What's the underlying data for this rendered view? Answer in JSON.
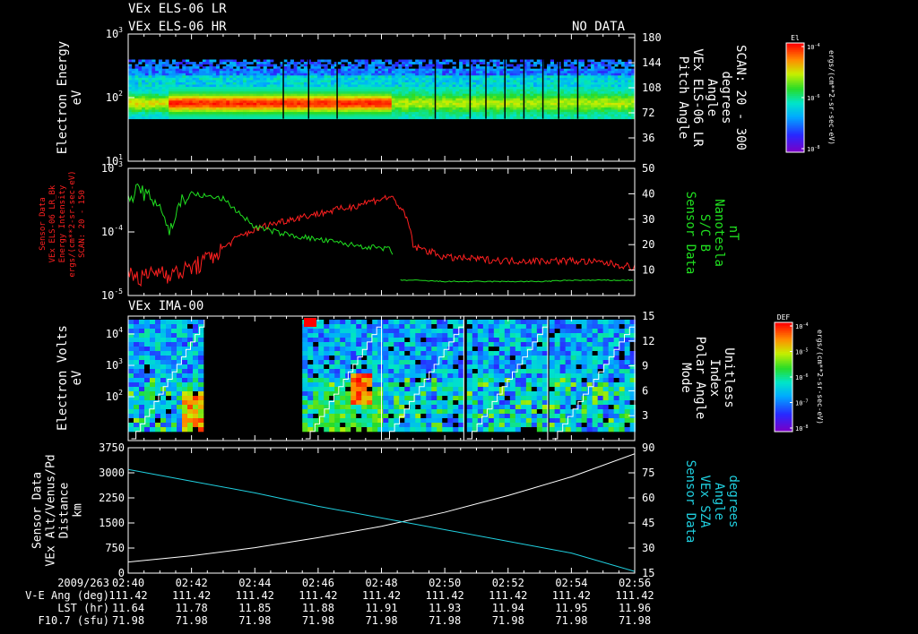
{
  "header": {
    "line1": "VEx ELS-06 LR",
    "line2": "VEx ELS-06 HR",
    "nodata": "NO DATA",
    "ima_title": "VEx IMA-00"
  },
  "panel1": {
    "ylabel": [
      "Electron Energy",
      "eV"
    ],
    "y_ticks": [
      {
        "exp": "3"
      },
      {
        "exp": "2"
      },
      {
        "exp": "1"
      }
    ],
    "y2_ticks": [
      "180",
      "144",
      "108",
      "72",
      "36"
    ],
    "y2label": [
      "Pitch Angle",
      "VEx ELS-06 LR",
      "Angle",
      "degrees",
      "SCAN: 20 - 300"
    ],
    "colorbar": {
      "title": "El",
      "tick_exps": [
        "-4",
        "-6",
        "-8"
      ],
      "label": "ergs/(cm**2-sr-sec-eV)"
    }
  },
  "panel2": {
    "ylabel": [
      "Sensor Data",
      "VEx ELS-06 LR_Bk",
      "Energy Intensity",
      "ergs/(cm**2-sr-sec-eV)",
      "SCAN: 20 - 150"
    ],
    "y_ticks": [
      {
        "exp": "-3"
      },
      {
        "exp": "-4"
      },
      {
        "exp": "-5"
      }
    ],
    "y2_ticks": [
      "50",
      "40",
      "30",
      "20",
      "10"
    ],
    "y2label": [
      "Sensor Data",
      "S/C B",
      "Nanotesla",
      "nT"
    ],
    "colors": {
      "red": "#ff2020",
      "green": "#20e020"
    }
  },
  "panel3": {
    "ylabel": [
      "Electron Volts",
      "eV"
    ],
    "y_ticks": [
      {
        "exp": "4"
      },
      {
        "exp": "3"
      },
      {
        "exp": "2"
      }
    ],
    "y2_ticks": [
      "15",
      "12",
      "9",
      "6",
      "3"
    ],
    "y2label": [
      "Mode",
      "Polar Angle",
      "Index",
      "Unitless"
    ],
    "colorbar": {
      "title": "DEF",
      "tick_exps": [
        "-4",
        "-5",
        "-6",
        "-7",
        "-8"
      ],
      "label": "ergs/(cm**2-sr-sec-eV)"
    }
  },
  "panel4": {
    "ylabel": [
      "Sensor Data",
      "VEx Alt/Venus/Pd",
      "Distance",
      "km"
    ],
    "y_ticks": [
      "3750",
      "3000",
      "2250",
      "1500",
      "750",
      "0"
    ],
    "y2_ticks": [
      "90",
      "75",
      "60",
      "45",
      "30",
      "15"
    ],
    "y2label": [
      "Sensor Data",
      "VEx SZA",
      "Angle",
      "degrees"
    ],
    "colors": {
      "alt": "#ffffff",
      "sza": "#20d0e0"
    }
  },
  "xaxis": {
    "ticks": [
      "02:40",
      "02:42",
      "02:44",
      "02:46",
      "02:48",
      "02:50",
      "02:52",
      "02:54",
      "02:56"
    ],
    "rows": [
      {
        "label": "2009/263",
        "values": [
          "02:40",
          "02:42",
          "02:44",
          "02:46",
          "02:48",
          "02:50",
          "02:52",
          "02:54",
          "02:56"
        ]
      },
      {
        "label": "V-E Ang (deg)",
        "values": [
          "111.42",
          "111.42",
          "111.42",
          "111.42",
          "111.42",
          "111.42",
          "111.42",
          "111.42",
          "111.42"
        ]
      },
      {
        "label": "LST (hr)",
        "values": [
          "11.64",
          "11.78",
          "11.85",
          "11.88",
          "11.91",
          "11.93",
          "11.94",
          "11.95",
          "11.96"
        ]
      },
      {
        "label": "F10.7 (sfu)",
        "values": [
          "71.98",
          "71.98",
          "71.98",
          "71.98",
          "71.98",
          "71.98",
          "71.98",
          "71.98",
          "71.98"
        ]
      }
    ]
  },
  "chart_data": [
    {
      "type": "heatmap",
      "title": "VEx ELS-06 LR",
      "ylabel": "Electron Energy eV",
      "yscale": "log",
      "ylim": [
        1,
        1000
      ],
      "y2label": "Pitch Angle VEx ELS-06 LR Angle degrees SCAN: 20 - 300",
      "y2lim": [
        0,
        180
      ],
      "x_range": [
        "02:40",
        "02:56"
      ],
      "colorbar": {
        "title": "El",
        "scale": "log",
        "range": [
          1e-08,
          0.001
        ],
        "unit": "ergs/(cm**2-sr-sec-eV)"
      },
      "energy_band": [
        10,
        250
      ],
      "intense_region": {
        "x": [
          "02:41",
          "02:48"
        ],
        "energy": [
          15,
          70
        ],
        "level": 0.0001
      },
      "gap_lines": [
        "02:45",
        "02:46",
        "02:47",
        "02:51",
        "02:52",
        "02:53",
        "02:54"
      ]
    },
    {
      "type": "line",
      "ylabel": "Sensor Data VEx ELS-06 LR_Bk Energy Intensity ergs/(cm**2-sr-sec-eV) SCAN: 20 - 150",
      "yscale": "log",
      "ylim": [
        2e-06,
        0.001
      ],
      "y2label": "Sensor Data S/C B Nanotesla nT",
      "y2lim": [
        0,
        50
      ],
      "series": [
        {
          "axis": "left",
          "color": "#ff2020",
          "x": [
            0,
            0.5,
            1,
            1.5,
            2,
            2.5,
            3,
            4,
            5,
            6,
            7,
            8.3,
            8.7,
            9,
            10,
            11,
            12,
            13,
            14,
            15,
            16
          ],
          "values": [
            6e-06,
            5e-06,
            7e-06,
            6e-06,
            8e-06,
            1.2e-05,
            2e-05,
            5e-05,
            8e-05,
            0.00011,
            0.00015,
            0.00025,
            0.00011,
            2.2e-05,
            1.3e-05,
            1.2e-05,
            1.1e-05,
            1.1e-05,
            1.1e-05,
            1e-05,
            8e-06
          ]
        },
        {
          "axis": "right",
          "color": "#20e020",
          "x": [
            0,
            0.3,
            0.7,
            1,
            1.3,
            1.7,
            2,
            3,
            4,
            5,
            6,
            7,
            8.3,
            8.6,
            9,
            10,
            11,
            12,
            13,
            14,
            15,
            16
          ],
          "values": [
            37,
            42,
            38,
            36,
            25,
            38,
            40,
            38,
            27,
            24,
            22,
            20,
            18,
            6,
            6,
            5.5,
            5.5,
            5.5,
            5.5,
            6,
            6,
            6
          ]
        }
      ]
    },
    {
      "type": "heatmap",
      "title": "VEx IMA-00",
      "ylabel": "Electron Volts eV",
      "yscale": "log",
      "ylim": [
        10,
        30000
      ],
      "y2label": "Mode Polar Angle Index Unitless",
      "y2lim": [
        0,
        15
      ],
      "x_range": [
        "02:40",
        "02:56"
      ],
      "colorbar": {
        "title": "DEF",
        "scale": "log",
        "range": [
          1e-09,
          0.0001
        ],
        "unit": "ergs/(cm**2-sr-sec-eV)"
      },
      "data_gap": [
        "02:42",
        "02:46"
      ],
      "intense_region": {
        "x": [
          "02:47.5",
          "02:48.5"
        ],
        "energy": [
          150,
          800
        ],
        "level": 1e-05
      },
      "polar_index_sweeps": [
        [
          "02:40",
          "02:42"
        ],
        [
          "02:46",
          "02:49"
        ],
        [
          "02:49",
          "02:52"
        ],
        [
          "02:52",
          "02:55"
        ],
        [
          "02:55",
          "02:56"
        ]
      ]
    },
    {
      "type": "line",
      "ylabel": "Sensor Data VEx Alt/Venus/Pd Distance km",
      "ylim": [
        0,
        3750
      ],
      "y2label": "Sensor Data VEx SZA Angle degrees",
      "y2lim": [
        15,
        90
      ],
      "x": [
        0,
        2,
        4,
        6,
        8,
        10,
        12,
        14,
        16
      ],
      "series": [
        {
          "axis": "left",
          "color": "#ffffff",
          "values": [
            330,
            520,
            760,
            1060,
            1400,
            1820,
            2320,
            2880,
            3570
          ]
        },
        {
          "axis": "right",
          "color": "#20d0e0",
          "values": [
            77,
            70,
            63,
            55,
            48,
            41,
            34,
            27,
            16
          ]
        }
      ]
    }
  ]
}
